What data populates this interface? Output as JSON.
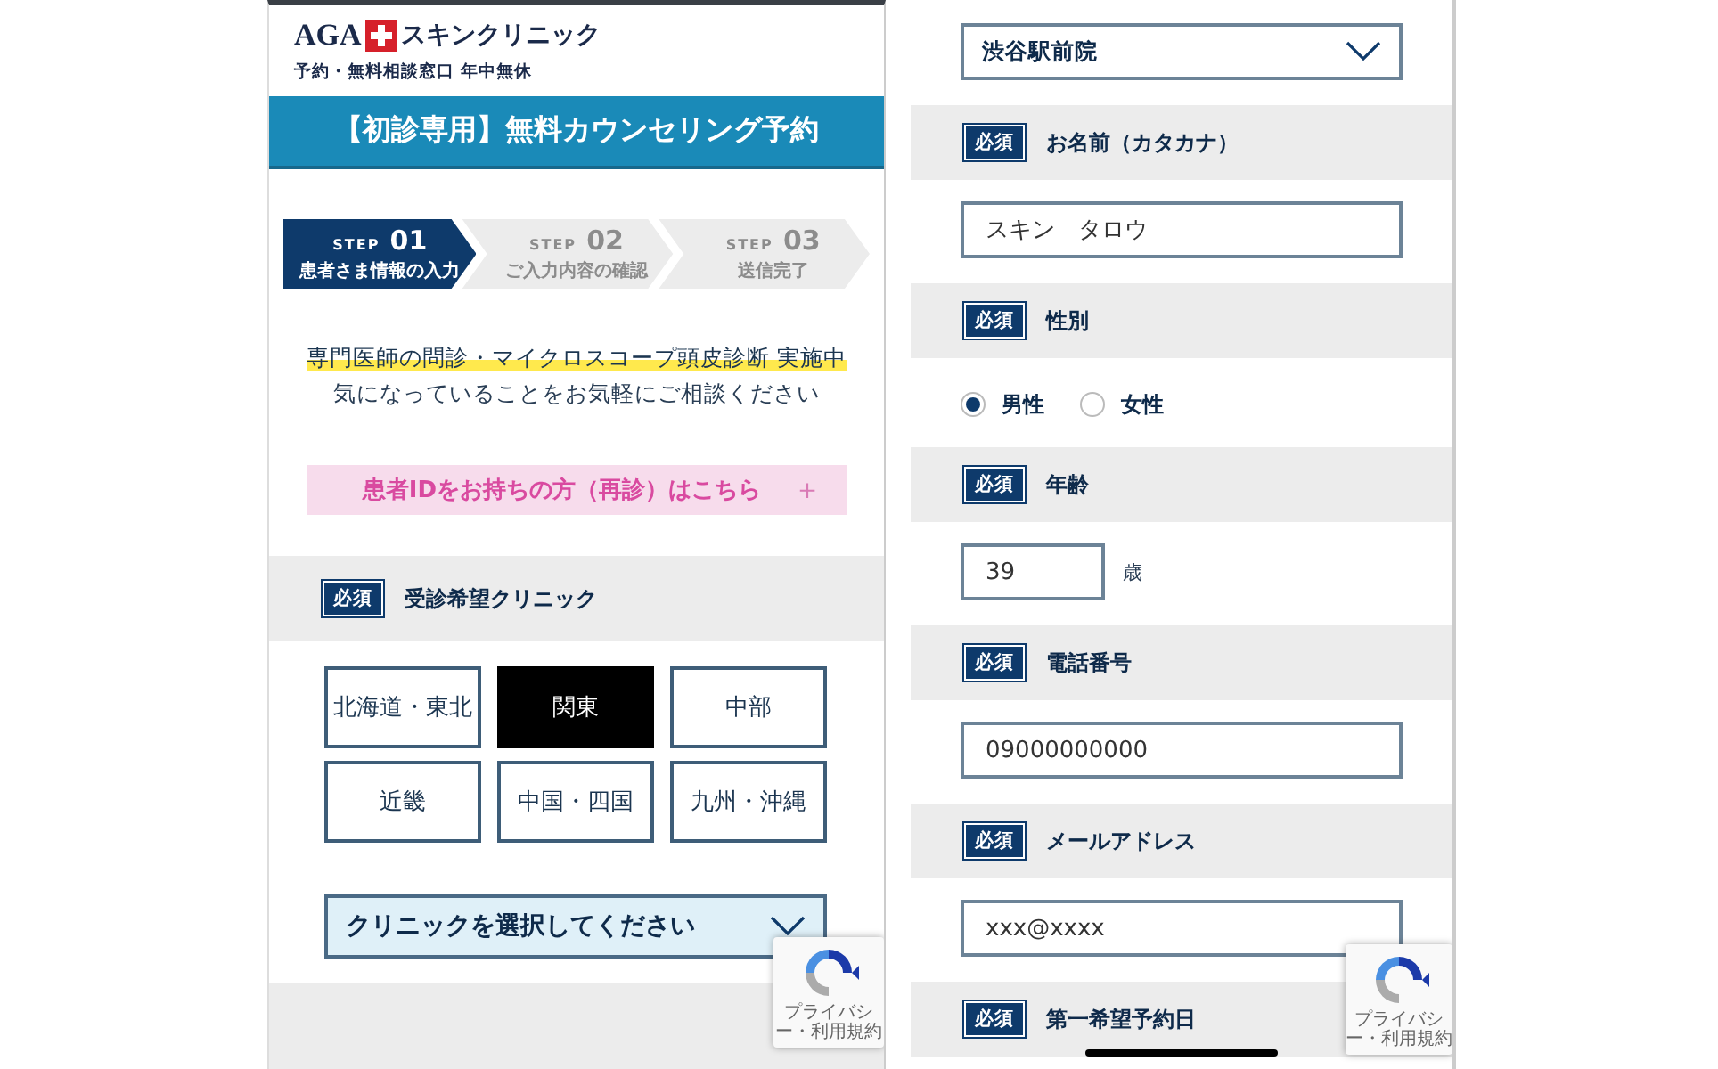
{
  "left": {
    "logo": {
      "brand": "AGA",
      "name": "スキンクリニック"
    },
    "tagline": "予約・無料相談窓口 年中無休",
    "banner": "【初診専用】無料カウンセリング予約",
    "steps": [
      {
        "label": "STEP",
        "number": "01",
        "caption": "患者さま情報の入力",
        "selected": true
      },
      {
        "label": "STEP",
        "number": "02",
        "caption": "ご入力内容の確認",
        "selected": false
      },
      {
        "label": "STEP",
        "number": "03",
        "caption": "送信完了",
        "selected": false
      }
    ],
    "intro": {
      "highlight": "専門医師の問診・マイクロスコープ頭皮診断 実施中",
      "note": "気になっていることをお気軽にご相談ください"
    },
    "returning_link": {
      "label": "患者IDをお持ちの方（再診）はこちら",
      "icon": "＋"
    },
    "clinic_section": {
      "badge": "必須",
      "label": "受診希望クリニック",
      "regions": [
        {
          "label": "北海道・東北",
          "selected": false
        },
        {
          "label": "関東",
          "selected": true
        },
        {
          "label": "中部",
          "selected": false
        },
        {
          "label": "近畿",
          "selected": false
        },
        {
          "label": "中国・四国",
          "selected": false
        },
        {
          "label": "九州・沖縄",
          "selected": false
        }
      ],
      "select": {
        "value": "クリニックを選択してください"
      }
    },
    "recaptcha": {
      "text": "プライバシー・利用規約"
    }
  },
  "right": {
    "clinic_select": {
      "value": "渋谷駅前院"
    },
    "fields": [
      {
        "kind": "text",
        "badge": "必須",
        "label": "お名前（カタカナ）",
        "value": "スキン　タロウ"
      },
      {
        "kind": "radio",
        "badge": "必須",
        "label": "性別",
        "options": [
          {
            "label": "男性",
            "selected": true
          },
          {
            "label": "女性",
            "selected": false
          }
        ]
      },
      {
        "kind": "age",
        "badge": "必須",
        "label": "年齢",
        "value": "39",
        "unit": "歳"
      },
      {
        "kind": "text",
        "badge": "必須",
        "label": "電話番号",
        "value": "09000000000"
      },
      {
        "kind": "text",
        "badge": "必須",
        "label": "メールアドレス",
        "value": "xxx@xxxx"
      },
      {
        "kind": "date",
        "badge": "必須",
        "label": "第一希望予約日"
      }
    ],
    "recaptcha": {
      "text": "プライバシー・利用規約"
    }
  }
}
